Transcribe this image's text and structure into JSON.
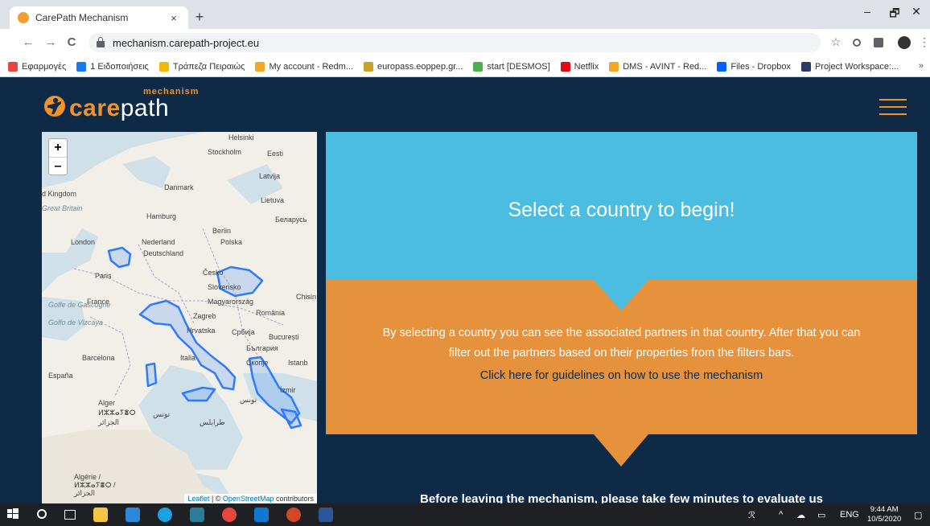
{
  "browser": {
    "tab_title": "CarePath Mechanism",
    "tab_close": "×",
    "new_tab": "+",
    "url": "mechanism.carepath-project.eu",
    "minimize": "–",
    "restore": "🗗",
    "close": "✕",
    "back": "←",
    "forward": "→",
    "reload": "C",
    "star": "☆",
    "menu": "⋮"
  },
  "bookmarks": [
    {
      "label": "Εφαρμογές",
      "icon": "apps-icon",
      "color": "#e8453c"
    },
    {
      "label": "1 Ειδοποιήσεις",
      "icon": "facebook-icon",
      "color": "#1877f2"
    },
    {
      "label": "Τράπεζα Πειραιώς",
      "icon": "bank-icon",
      "color": "#f5b800"
    },
    {
      "label": "My account - Redm...",
      "icon": "redmine-icon",
      "color": "#f5a623"
    },
    {
      "label": "europass.eoppep.gr...",
      "icon": "europass-icon",
      "color": "#c9a227"
    },
    {
      "label": "start [DESMOS]",
      "icon": "desmos-icon",
      "color": "#4caf50"
    },
    {
      "label": "Netflix",
      "icon": "netflix-icon",
      "color": "#e50914"
    },
    {
      "label": "DMS - AVINT - Red...",
      "icon": "redmine-icon",
      "color": "#f5a623"
    },
    {
      "label": "Files - Dropbox",
      "icon": "dropbox-icon",
      "color": "#0061ff"
    },
    {
      "label": "Project Workspace:...",
      "icon": "workspace-icon",
      "color": "#2b3a67"
    }
  ],
  "bookmarks_more": "»",
  "logo": {
    "care": "care",
    "path": "path",
    "mechanism": "mechanism"
  },
  "map": {
    "zoom_in": "+",
    "zoom_out": "–",
    "attribution_leaflet": "Leaflet",
    "attribution_sep": " | © ",
    "attribution_osm": "OpenStreetMap",
    "attribution_suffix": " contributors",
    "labels": [
      "Helsinki",
      "Stockholm",
      "Eesti",
      "Latvija",
      "Danmark",
      "d Kingdom",
      "Great Britain",
      "Lietuva",
      "Hamburg",
      "Беларусь",
      "Berlin",
      "Nederland",
      "London",
      "Polska",
      "Deutschland",
      "Česko",
      "Paris",
      "Slovensko",
      "France",
      "Magyarország",
      "Chisin",
      "România",
      "Zagreb",
      "Golfe de Gascogne",
      "Hrvatska",
      "Србија",
      "București",
      "Golfo de Vizcaya",
      "България",
      "Barcelona",
      "Italia",
      "Скопје",
      "Istanb",
      "España",
      "İzmir",
      "تونس",
      "Alger",
      "ⵍⵣⵣⴰⵢⴻⵔ",
      "الجزائر",
      "تونس",
      "طرابلس",
      "Algérie /",
      "ⵍⵣⵣⴰⵢⴻⵔ /",
      "الجزائر"
    ]
  },
  "content": {
    "heading": "Select a country to begin!",
    "description": "By selecting a country you can see the associated partners in that country. After that you can filter out the partners based on their properties from the filters bars.",
    "guidelines_link": "Click here for guidelines on how to use the mechanism",
    "evaluate": "Before leaving the mechanism, please take few minutes to evaluate us"
  },
  "taskbar": {
    "lang": "ENG",
    "time": "9:44 AM",
    "date": "10/5/2020"
  },
  "colors": {
    "page_bg": "#0e2a47",
    "accent_orange": "#e6913c",
    "accent_blue": "#4bbde0",
    "highlight_country": "#2f7bff"
  }
}
